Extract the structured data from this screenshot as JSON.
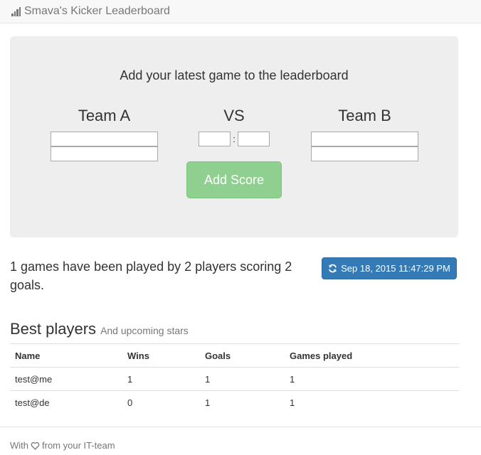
{
  "navbar": {
    "brand_icon": "signal-icon",
    "brand": "Smava's Kicker Leaderboard"
  },
  "form": {
    "title": "Add your latest game to the leaderboard",
    "team_a": {
      "label": "Team A",
      "player1": "",
      "player2": ""
    },
    "vs_label": "VS",
    "score_separator": ":",
    "score_a": "",
    "score_b": "",
    "team_b": {
      "label": "Team B",
      "player1": "",
      "player2": ""
    },
    "submit_label": "Add Score",
    "submit_color": "#8fcf8f"
  },
  "stats": {
    "text": "1 games have been played by 2 players scoring 2 goals.",
    "refresh_icon": "refresh-icon",
    "refresh_label": "Sep 18, 2015 11:47:29 PM",
    "refresh_color": "#337ab7"
  },
  "best_players": {
    "title": "Best players",
    "subtitle": "And upcoming stars",
    "columns": [
      "Name",
      "Wins",
      "Goals",
      "Games played"
    ],
    "rows": [
      [
        "test@me",
        "1",
        "1",
        "1"
      ],
      [
        "test@de",
        "0",
        "1",
        "1"
      ]
    ]
  },
  "footer": {
    "prefix": "With",
    "icon": "heart-icon",
    "suffix": "from your IT-team"
  }
}
